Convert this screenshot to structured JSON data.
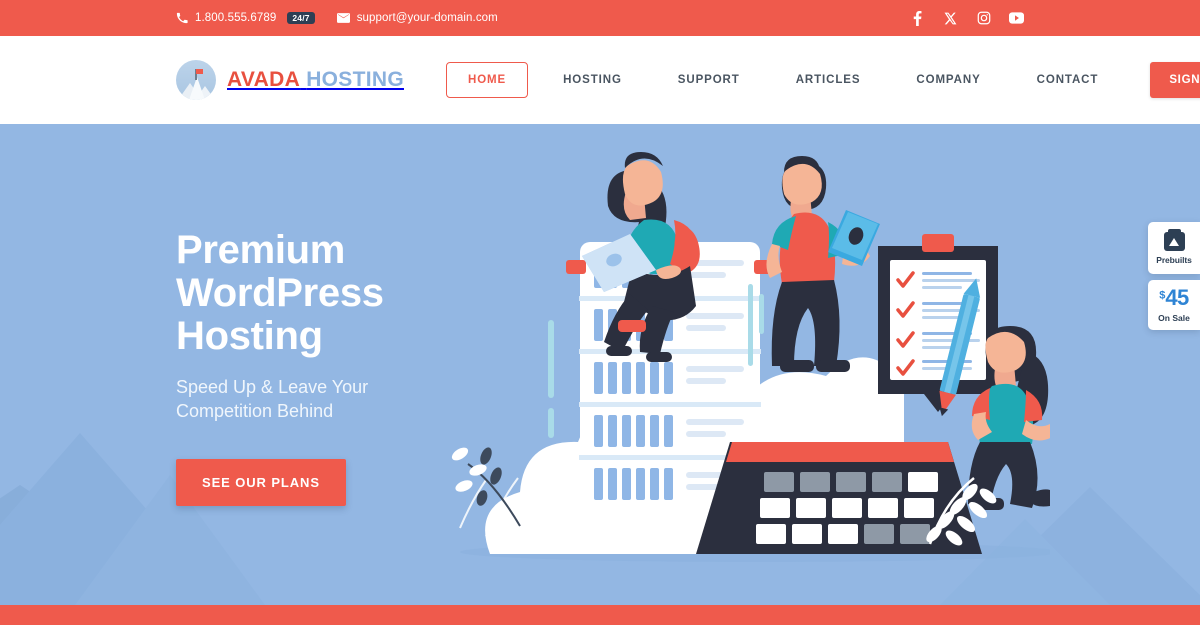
{
  "topbar": {
    "phone": "1.800.555.6789",
    "phone_badge": "24/7",
    "email": "support@your-domain.com",
    "socials": [
      {
        "name": "facebook-icon",
        "label": "Facebook"
      },
      {
        "name": "x-twitter-icon",
        "label": "X"
      },
      {
        "name": "instagram-icon",
        "label": "Instagram"
      },
      {
        "name": "youtube-icon",
        "label": "YouTube"
      }
    ],
    "background_color": "#ef5a4c"
  },
  "header": {
    "logo": {
      "name_part1": "AVADA",
      "name_part2": "HOSTING",
      "color_part1": "#e8503f",
      "color_part2": "#8ab0dd"
    },
    "nav": [
      {
        "label": "HOME",
        "active": true
      },
      {
        "label": "HOSTING",
        "active": false
      },
      {
        "label": "SUPPORT",
        "active": false
      },
      {
        "label": "ARTICLES",
        "active": false
      },
      {
        "label": "COMPANY",
        "active": false
      },
      {
        "label": "CONTACT",
        "active": false
      }
    ],
    "signup_label": "SIGN UP!"
  },
  "hero": {
    "heading_line1": "Premium",
    "heading_line2": "WordPress",
    "heading_line3": "Hosting",
    "subheading_line1": "Speed Up & Leave Your",
    "subheading_line2": "Competition Behind",
    "cta_label": "SEE OUR PLANS",
    "background_color": "#93b7e3",
    "accent_color": "#ef5a4c"
  },
  "widgets": [
    {
      "id": "prebuilts",
      "label": "Prebuilts",
      "icon": "prebuilts-bag-icon"
    },
    {
      "id": "on-sale",
      "currency": "$",
      "price": "45",
      "label": "On Sale",
      "price_color": "#2f84d4"
    }
  ]
}
